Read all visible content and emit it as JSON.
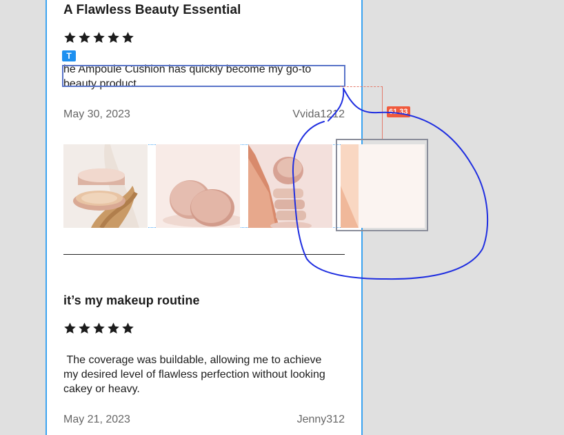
{
  "reviews": [
    {
      "title": "A Flawless Beauty Essential",
      "rating": 5,
      "body": "he Ampoule Cushion has quickly become my go-to beauty product.",
      "date": "May 30, 2023",
      "user": "Vvida1212"
    },
    {
      "title": "it’s my makeup routine",
      "rating": 5,
      "body": " The coverage was buildable, allowing me to achieve my desired level of flawless perfection without looking cakey or heavy.",
      "date": "May 21, 2023",
      "user": "Jenny312"
    }
  ],
  "editor": {
    "text_tool_tag": "T",
    "measurement": "61.33",
    "selection_color": "#5873c8",
    "frame_color": "#3aa3f0",
    "measure_color": "#f05a3d",
    "annotation_color": "#1f2ee0"
  },
  "icons": {
    "star": "star-icon",
    "text_tool": "text-tool-icon"
  },
  "gallery": {
    "thumbnails": [
      {
        "name": "cushion-with-ribbon-photo"
      },
      {
        "name": "two-compacts-photo"
      },
      {
        "name": "stacked-compacts-photo"
      },
      {
        "name": "peach-abstract-photo"
      }
    ]
  }
}
